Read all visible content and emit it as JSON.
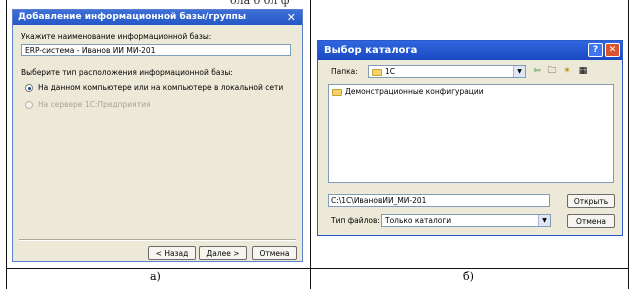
{
  "panel_a": {
    "title": "Добавление информационной базы/группы",
    "name_label": "Укажите наименование информационной базы:",
    "name_value": "ERP-система - Иванов ИИ МИ-201",
    "location_label": "Выберите тип расположения информационной базы:",
    "option_local": "На данном компьютере или на компьютере в локальной сети",
    "option_server": "На сервере 1С:Предприятия",
    "back_button": "< Назад",
    "next_button": "Далее >",
    "cancel_button": "Отмена",
    "caption": "а)"
  },
  "panel_b": {
    "title": "Выбор каталога",
    "folder_label": "Папка:",
    "folder_value": "1С",
    "list_items": [
      "Демонстрационные конфигурации"
    ],
    "path_value": "C:\\1C\\ИвановИИ_МИ-201",
    "open_button": "Открыть",
    "filetype_label": "Тип файлов:",
    "filetype_value": "Только каталоги",
    "cancel_button": "Отмена",
    "caption": "б)"
  }
}
